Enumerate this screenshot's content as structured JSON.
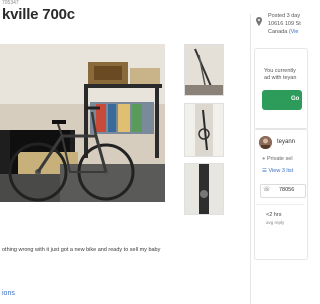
{
  "ad": {
    "id_text": "705347",
    "title": "kville 700c",
    "description": "othing wrong with it just got a new bike and ready to sell my baby",
    "bottom_link": "ions"
  },
  "location": {
    "posted": "Posted 3 day",
    "address": "10616 109 St",
    "city": "Canada",
    "view_link": "(Vie"
  },
  "contact_card": {
    "line1": "You currently",
    "line2": "ad with teyan",
    "button_label": "Go"
  },
  "seller": {
    "name": "teyann",
    "private_label": "Private sel",
    "listings_label": "View 3 list",
    "phone": "78056",
    "reply_time": "<2 hrs",
    "reply_sub": "avg reply"
  },
  "colors": {
    "accent_green": "#2d9c5a",
    "link_blue": "#3a6fc4"
  }
}
